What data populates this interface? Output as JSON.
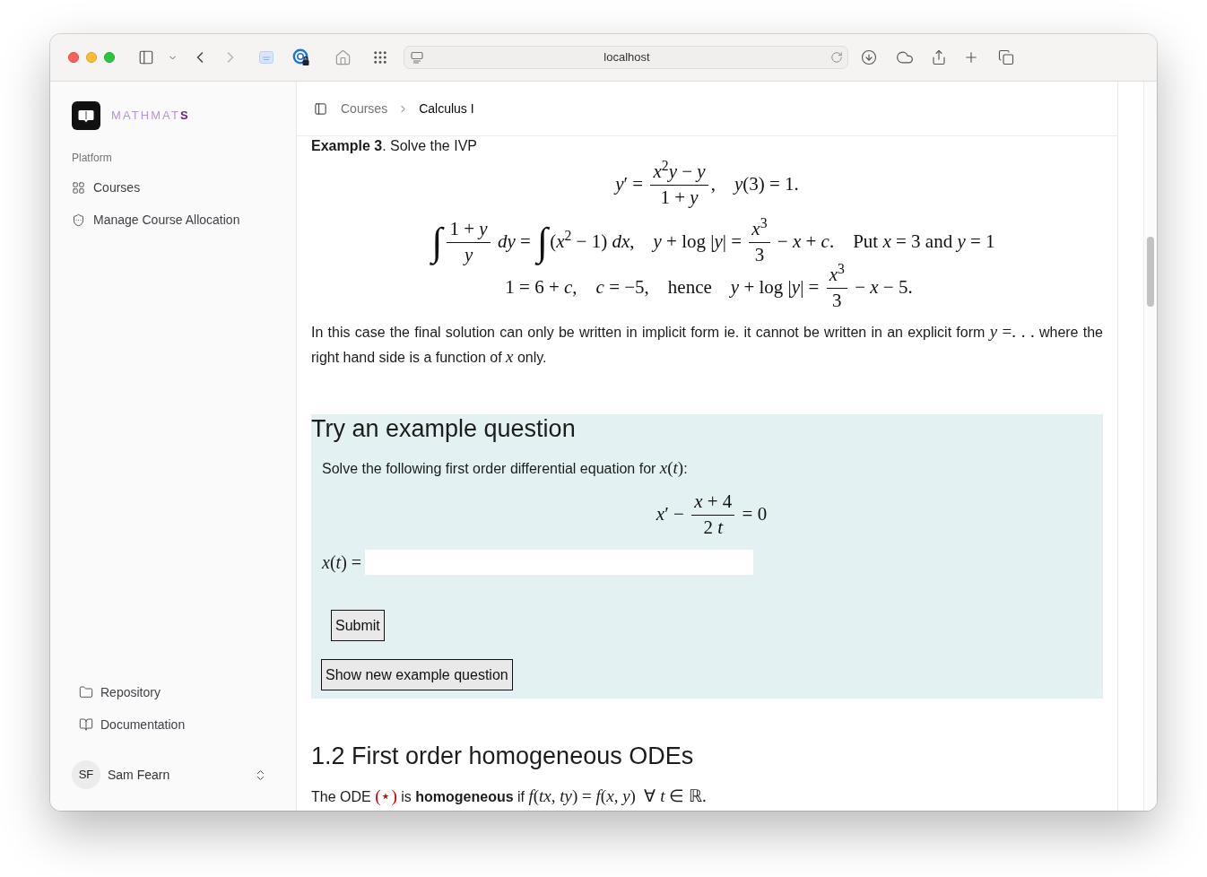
{
  "browser": {
    "address": "localhost"
  },
  "sidebar": {
    "logo": "MATHMAT**S**",
    "section_label": "Platform",
    "nav_items": [
      {
        "label": "Courses"
      },
      {
        "label": "Manage Course Allocation"
      }
    ],
    "footer_items": [
      {
        "label": "Repository"
      },
      {
        "label": "Documentation"
      }
    ],
    "user": {
      "initials": "SF",
      "name": "Sam Fearn"
    }
  },
  "header": {
    "breadcrumb": [
      {
        "label": "Courses",
        "current": false
      },
      {
        "label": "Calculus I",
        "current": true
      }
    ]
  },
  "content": {
    "partial_heading": "**Example 3**. Solve the IVP",
    "equations": [
      [
        {
          "kind": "math",
          "text": "*y*′ = "
        },
        {
          "kind": "frac",
          "num": "*x*$^{2}$*y* − *y*",
          "den": "1 + *y*"
        },
        {
          "kind": "math",
          "text": ",    *y*(3) = 1."
        }
      ],
      [
        {
          "kind": "integral",
          "text": "∫"
        },
        {
          "kind": "frac",
          "num": "1 + *y*",
          "den": "*y*"
        },
        {
          "kind": "math",
          "text": " *dy* = "
        },
        {
          "kind": "integral",
          "text": "∫"
        },
        {
          "kind": "math",
          "text": "(*x*$^{2}$ − 1) *dx*,    *y* + log |*y*| = "
        },
        {
          "kind": "frac",
          "num": "*x*$^{3}$",
          "den": "3"
        },
        {
          "kind": "math",
          "text": " − *x* + *c*.    Put *x* = 3 and *y* = 1"
        }
      ],
      [
        {
          "kind": "math",
          "text": "1 = 6 + *c*,    *c* = −5,    hence    *y* + log |*y*| = "
        },
        {
          "kind": "frac",
          "num": "*x*$^{3}$",
          "den": "3"
        },
        {
          "kind": "math",
          "text": " − *x* − 5."
        }
      ]
    ],
    "paragraph": [
      {
        "kind": "text",
        "text": "In this case the final solution can only be written in implicit form ie. it cannot be written in an explicit form "
      },
      {
        "kind": "math",
        "text": "*y* =. . ."
      },
      {
        "kind": "text",
        "text": " where the right hand side is a function of "
      },
      {
        "kind": "math",
        "text": "*x*"
      },
      {
        "kind": "text",
        "text": " only."
      }
    ],
    "example": {
      "title": "Try an example question",
      "prompt": [
        {
          "kind": "text",
          "text": "Solve the following first order differential equation for "
        },
        {
          "kind": "math",
          "text": "*x*(*t*)"
        },
        {
          "kind": "text",
          "text": ":"
        }
      ],
      "equation": [
        {
          "kind": "math",
          "text": "*x*′ − "
        },
        {
          "kind": "frac",
          "num": "*x* + 4",
          "den": "2 *t*"
        },
        {
          "kind": "math",
          "text": " = 0"
        }
      ],
      "answer_label": "*x*(*t*) =",
      "submit": "Submit",
      "new_question": "Show new example question"
    },
    "section": {
      "title": "1.2 First order homogeneous ODEs",
      "paragraph": [
        {
          "kind": "text",
          "text": "The ODE "
        },
        {
          "kind": "ref",
          "text": "(⋆)"
        },
        {
          "kind": "text",
          "text": " is **homogeneous** if "
        },
        {
          "kind": "math",
          "text": "*f*(*tx*, *ty*) = *f*(*x*, *y*)  ∀ *t* ∈ ℝ."
        }
      ]
    }
  }
}
